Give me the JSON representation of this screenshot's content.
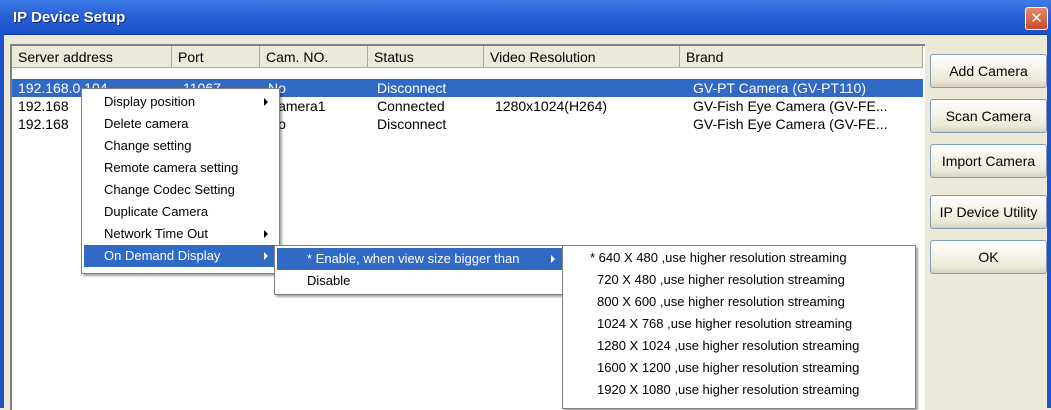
{
  "window": {
    "title": "IP Device Setup",
    "close_glyph": "✕"
  },
  "table": {
    "headers": [
      "Server address",
      "Port",
      "Cam. NO.",
      "Status",
      "Video Resolution",
      "Brand"
    ],
    "rows": [
      {
        "server": "192.168.0.104",
        "port": "11067",
        "cam": "No",
        "status": "Disconnect",
        "res": "",
        "brand": "GV-PT Camera (GV-PT110)"
      },
      {
        "server": "192.168",
        "port": "",
        "cam": "Camera1",
        "status": "Connected",
        "res": "1280x1024(H264)",
        "brand": "GV-Fish Eye Camera (GV-FE..."
      },
      {
        "server": "192.168",
        "port": "",
        "cam": "No",
        "status": "Disconnect",
        "res": "",
        "brand": "GV-Fish Eye Camera (GV-FE..."
      }
    ]
  },
  "buttons": [
    "Add Camera",
    "Scan Camera",
    "Import Camera",
    "IP Device Utility",
    "OK"
  ],
  "context_menu": [
    {
      "label": "Display position",
      "submenu": true
    },
    {
      "label": "Delete camera",
      "submenu": false
    },
    {
      "label": "Change setting",
      "submenu": false
    },
    {
      "label": "Remote camera setting",
      "submenu": false
    },
    {
      "label": "Change Codec Setting",
      "submenu": false
    },
    {
      "label": "Duplicate Camera",
      "submenu": false
    },
    {
      "label": "Network Time Out",
      "submenu": true
    },
    {
      "label": "On Demand Display",
      "submenu": true,
      "selected": true
    }
  ],
  "submenu": [
    {
      "label": "* Enable, when view size bigger than",
      "submenu": true,
      "selected": true
    },
    {
      "label": "Disable",
      "submenu": false
    }
  ],
  "resolution_menu": [
    "* 640 X 480 ,use higher resolution streaming",
    "720 X 480 ,use higher resolution streaming",
    "800 X 600 ,use higher resolution streaming",
    "1024 X 768 ,use higher resolution streaming",
    "1280 X 1024 ,use higher resolution streaming",
    "1600 X 1200 ,use higher resolution streaming",
    "1920 X 1080 ,use higher resolution streaming"
  ],
  "colors": {
    "titlebar": "#2a63d8",
    "selection": "#316ac5",
    "face": "#ece9d8"
  }
}
